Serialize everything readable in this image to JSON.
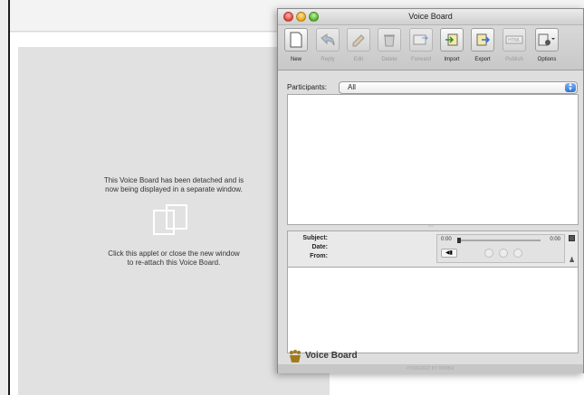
{
  "applet": {
    "detached_line1": "This Voice Board has been detached and is",
    "detached_line2": "now being displayed in a separate window.",
    "reattach_line1": "Click this applet or close the new window",
    "reattach_line2": "to re-attach this Voice Board."
  },
  "window": {
    "title": "Voice Board"
  },
  "toolbar": {
    "buttons": [
      {
        "label": "New",
        "icon": "new-document-icon",
        "enabled": true
      },
      {
        "label": "Reply",
        "icon": "reply-icon",
        "enabled": false
      },
      {
        "label": "Edit",
        "icon": "edit-icon",
        "enabled": false
      },
      {
        "label": "Delete",
        "icon": "delete-icon",
        "enabled": false
      },
      {
        "label": "Forward",
        "icon": "forward-icon",
        "enabled": false
      },
      {
        "label": "Import",
        "icon": "import-icon",
        "enabled": true
      },
      {
        "label": "Export",
        "icon": "export-icon",
        "enabled": true
      },
      {
        "label": "Publish",
        "icon": "html-publish-icon",
        "enabled": false
      },
      {
        "label": "Options",
        "icon": "options-gear-icon",
        "enabled": true
      }
    ]
  },
  "participants": {
    "label": "Participants:",
    "selected": "All"
  },
  "message_header": {
    "subject_label": "Subject:",
    "date_label": "Date:",
    "from_label": "From:"
  },
  "player": {
    "elapsed": "0:00",
    "total": "0:00",
    "progress": 0
  },
  "brand": {
    "name": "Voice Board",
    "footer": "POWERED BY WIMBA"
  },
  "colors": {
    "close": "#e0443a",
    "minimize": "#e2a61c",
    "maximize": "#4fb52b",
    "select_arrow": "#2f72d6"
  }
}
